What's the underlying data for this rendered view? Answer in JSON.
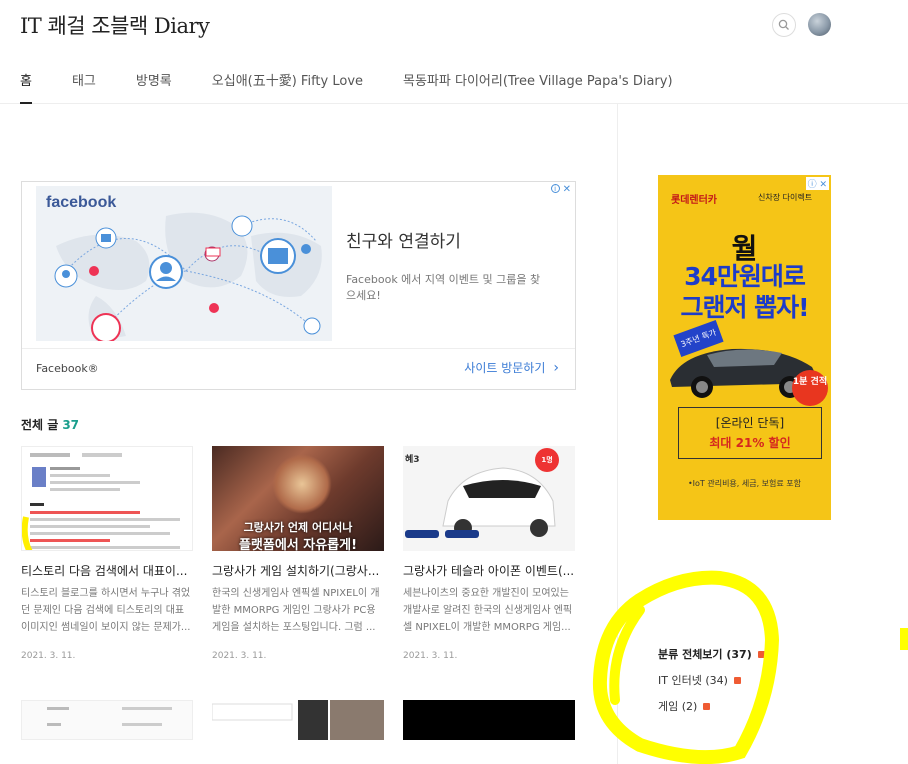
{
  "header": {
    "blog_title": "IT 쾌걸 조블랙 Diary",
    "search_icon": "search-icon",
    "avatar_icon": "avatar"
  },
  "nav": [
    {
      "label": "홈",
      "active": true
    },
    {
      "label": "태그"
    },
    {
      "label": "방명록"
    },
    {
      "label": "오십애(五十愛) Fifty Love"
    },
    {
      "label": "목동파파 다이어리(Tree Village Papa's Diary)"
    }
  ],
  "fb_ad": {
    "logo": "facebook",
    "headline": "친구와 연결하기",
    "description": "Facebook 에서 지역 이벤트 및 그룹을 찾으세요!",
    "brand": "Facebook®",
    "visit_label": "사이트 방문하기",
    "ad_choice_icon": "adchoices-icon"
  },
  "posts_section": {
    "label": "전체 글",
    "count": "37"
  },
  "posts": [
    {
      "title": "티스토리 다음 검색에서 대표이...",
      "excerpt": "티스토리 블로그를 하시면서 누구나 겪었던 문제인 다음 검색에 티스토리의 대표 이미지인 썸네일이 보이지 않는 문제가...",
      "date": "2021. 3. 11."
    },
    {
      "title": "그랑사가 게임 설치하기(그랑사...",
      "excerpt": "한국의 신생게임사 엔픽셀 NPIXEL이 개발한 MMORPG 게임인 그랑사가 PC용 게임을 설치하는 포스팅입니다. 그럼 ...",
      "date": "2021. 3. 11.",
      "thumb_text_1": "그랑사가 언제 어디서나",
      "thumb_text_2": "플랫폼에서 자유롭게!"
    },
    {
      "title": "그랑사가 테슬라 아이폰 이벤트(...",
      "excerpt": "세븐나이츠의 중요한 개발진이 모여있는 개발사로 알려진 한국의 신생게임사 엔픽셀 NPIXEL이 개발한 MMORPG 게임...",
      "date": "2021. 3. 11.",
      "thumb_badge": "1명",
      "thumb_label": "혜3"
    }
  ],
  "side_ad": {
    "brand": "롯데렌터카",
    "brand_sub": "신차장 다이렉트",
    "line1": "월",
    "line2": "34만원대로",
    "line3": "그랜저 뽑자!",
    "promo": "3주년 특가",
    "badge": "1분 견적",
    "box1": "[온라인 단독]",
    "box2": "최대 21% 할인",
    "footer": "•IoT 관리비용, 세금, 보험료 포함"
  },
  "categories": [
    {
      "label": "분류 전체보기 (37)",
      "all": true
    },
    {
      "label": "IT 인터넷 (34)"
    },
    {
      "label": "게임 (2)"
    }
  ],
  "colors": {
    "accent": "#1a9e8c",
    "facebook_blue": "#3b5998",
    "highlight_yellow": "#ffff00",
    "new_badge": "#ef5b33"
  }
}
